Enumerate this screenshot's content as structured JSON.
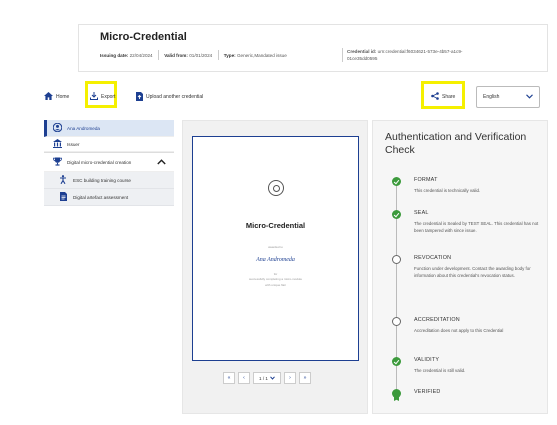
{
  "header": {
    "title": "Micro-Credential",
    "issuing_label": "Issuing date:",
    "issuing_value": "22/04/2024",
    "valid_label": "Valid from:",
    "valid_value": "01/01/2024",
    "type_label": "Type:",
    "type_value": "Generic,Mandated issue",
    "credential_label": "Credential id:",
    "credential_value": "urn:credential:f6034621-573e-4b57-a1c9-01ce35dd0595"
  },
  "toolbar": {
    "home_label": "Home",
    "export_label": "Export",
    "upload_label": "Upload another credential",
    "share_label": "Share",
    "language_value": "English",
    "icons": {
      "home": "home-icon",
      "export": "export-icon",
      "upload": "upload-icon",
      "share": "share-icon",
      "language": "chevron-down-icon"
    }
  },
  "sidebar": {
    "items": [
      {
        "label": "Ana Andromeda",
        "icon": "person-icon"
      },
      {
        "label": "Issuer",
        "icon": "institution-icon"
      },
      {
        "label": "Digital micro-credential creation",
        "icon": "trophy-icon"
      }
    ],
    "sub_items": [
      {
        "label": "ESC building training course",
        "icon": "activity-icon"
      },
      {
        "label": "Digital artefact assessment",
        "icon": "document-icon"
      }
    ]
  },
  "viewer": {
    "doc_title": "Micro-Credential",
    "doc_awarded": "awarded to",
    "doc_name": "Ana Andromeda",
    "doc_line1": "for",
    "doc_line2": "successfully completing a micro-module",
    "doc_line3": "with unique flair",
    "page_indicator": "1 / 1",
    "pager": {
      "first": "«",
      "prev": "‹",
      "next": "›",
      "last": "»"
    }
  },
  "auth": {
    "title": "Authentication and Verification Check",
    "checks": [
      {
        "title": "FORMAT",
        "desc": "This credential is technically valid.",
        "status": "ok"
      },
      {
        "title": "SEAL",
        "desc": "The credential is Sealed by TEST SEAL. This credential has not been tampered with since issue.",
        "status": "ok"
      },
      {
        "title": "REVOCATION",
        "desc": "Function under development. Contact the awarding body for information about this credential's revocation status.",
        "status": "pending"
      },
      {
        "title": "ACCREDITATION",
        "desc": "Accreditation does not apply to this Credential",
        "status": "pending"
      },
      {
        "title": "VALIDITY",
        "desc": "The credential is still valid.",
        "status": "ok"
      },
      {
        "title": "VERIFIED",
        "desc": "",
        "status": "verified"
      }
    ]
  },
  "colors": {
    "accent": "#1d3f91",
    "highlight": "#f5f000",
    "success": "#3c9a3c",
    "sidebar_active": "#dce6f4"
  }
}
